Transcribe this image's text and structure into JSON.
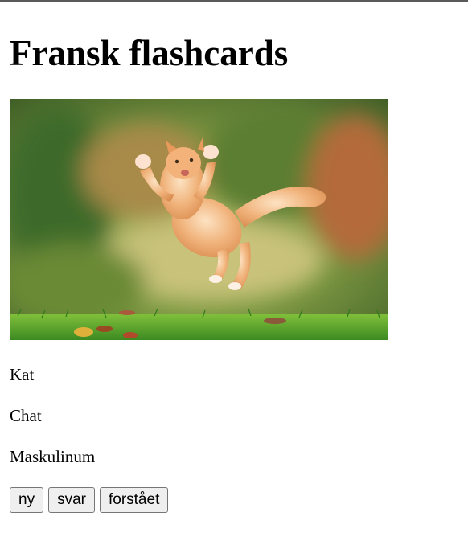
{
  "page": {
    "title": "Fransk flashcards"
  },
  "card": {
    "image_description": "cat",
    "danish": "Kat",
    "french": "Chat",
    "gender": "Maskulinum"
  },
  "buttons": {
    "new": "ny",
    "answer": "svar",
    "understood": "forstået"
  },
  "colors": {
    "grass": "#4f9a2c",
    "cat_fur": "#e9a66a",
    "background_blur": "#6f8a3c"
  }
}
